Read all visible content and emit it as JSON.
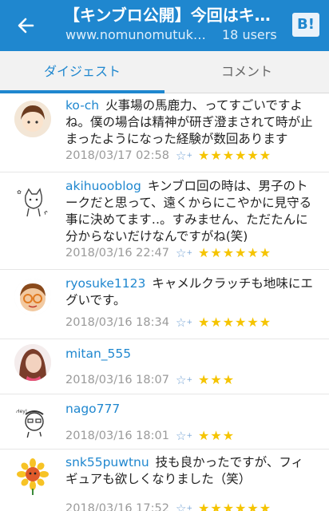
{
  "header": {
    "title": "【キンブロ公開】今回はキ…",
    "url": "www.nomunomutuk…",
    "users": "18 users",
    "badge": "B!"
  },
  "tabs": [
    {
      "label": "ダイジェスト",
      "active": true
    },
    {
      "label": "コメント",
      "active": false
    }
  ],
  "comments": [
    {
      "user": "ko-ch",
      "text": "火事場の馬鹿力、ってすごいですよね。僕の場合は精神が研ぎ澄まされて時が止まったようになった経験が数回あります",
      "date": "2018/03/17 02:58",
      "star_add_icon": "add-star-icon",
      "stars": "★★★★★★"
    },
    {
      "user": "akihuooblog",
      "text": "キンブロ回の時は、男子のトークだと思って、遠くからにこやかに見守る事に決めてます‥。すみません、ただたんに分からないだけなんですがね(笑)",
      "date": "2018/03/16 22:47",
      "star_add_icon": "add-star-icon",
      "stars": "★★★★★★"
    },
    {
      "user": "ryosuke1123",
      "text": "キャメルクラッチも地味にエグいです。",
      "date": "2018/03/16 18:34",
      "star_add_icon": "add-star-icon",
      "stars": "★★★★★★"
    },
    {
      "user": "mitan_555",
      "text": "",
      "date": "2018/03/16 18:07",
      "star_add_icon": "add-star-icon",
      "stars": "★★★"
    },
    {
      "user": "nago777",
      "text": "",
      "date": "2018/03/16 18:01",
      "star_add_icon": "add-star-icon",
      "stars": "★★★"
    },
    {
      "user": "snk55puwtnu",
      "text": "技も良かったですが、フィギュアも欲しくなりました（笑）",
      "date": "2018/03/16 17:52",
      "star_add_icon": "add-star-icon",
      "stars": "★★★★★★"
    }
  ],
  "colors": {
    "accent": "#1f87cf",
    "star": "#f5c400"
  }
}
